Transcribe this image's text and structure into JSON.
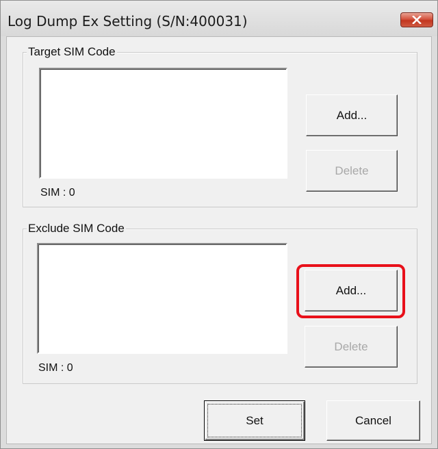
{
  "window": {
    "title": "Log Dump Ex Setting (S/N:400031)",
    "close_icon": "close-x-icon"
  },
  "target_group": {
    "label": "Target SIM Code",
    "count_label": "SIM : 0",
    "add_label": "Add...",
    "delete_label": "Delete",
    "delete_enabled": false
  },
  "exclude_group": {
    "label": "Exclude SIM Code",
    "count_label": "SIM : 0",
    "add_label": "Add...",
    "delete_label": "Delete",
    "delete_enabled": false,
    "add_highlighted": true,
    "highlight_color": "#e8101a"
  },
  "footer": {
    "set_label": "Set",
    "cancel_label": "Cancel"
  }
}
